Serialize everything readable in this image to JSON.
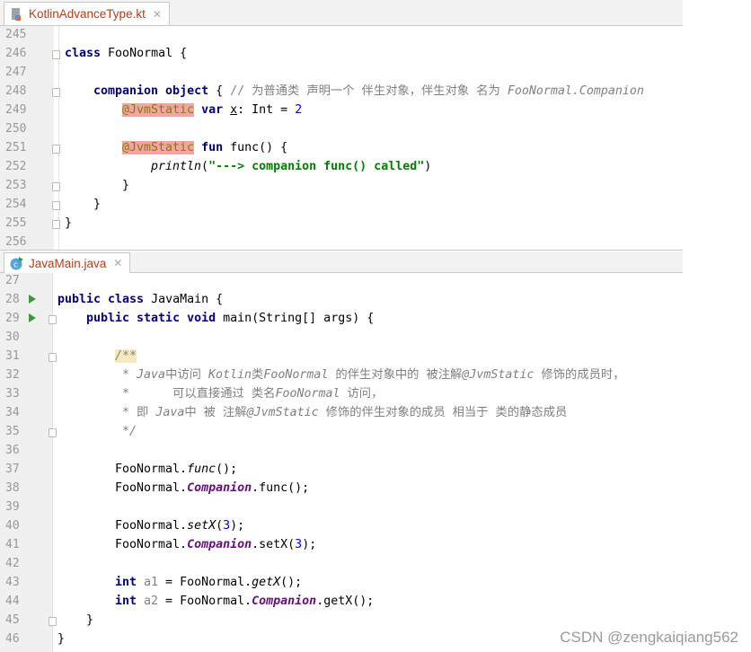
{
  "top_editor": {
    "tab": {
      "label": "KotlinAdvanceType.kt",
      "icon": "kotlin-file-icon"
    },
    "lines": [
      {
        "n": "245",
        "indent": 0,
        "fold": false,
        "tokens": []
      },
      {
        "n": "246",
        "indent": 0,
        "fold": true,
        "tokens": [
          [
            "class ",
            "kw0"
          ],
          [
            "FooNormal {",
            ""
          ]
        ]
      },
      {
        "n": "247",
        "indent": 0,
        "fold": false,
        "tokens": []
      },
      {
        "n": "248",
        "indent": 4,
        "fold": true,
        "tokens": [
          [
            "companion object",
            "kw"
          ],
          [
            " { ",
            ""
          ],
          [
            "// 为普通类 声明一个 伴生对象，伴生对象 名为 ",
            "cmt"
          ],
          [
            "FooNormal.Companion",
            "cm"
          ]
        ]
      },
      {
        "n": "249",
        "indent": 8,
        "fold": false,
        "tokens": [
          [
            "@JvmStatic",
            "ann"
          ],
          [
            " ",
            ""
          ],
          [
            "var",
            "kw"
          ],
          [
            " ",
            ""
          ],
          [
            "x",
            "und"
          ],
          [
            ": Int = ",
            ""
          ],
          [
            "2",
            "num"
          ]
        ]
      },
      {
        "n": "250",
        "indent": 0,
        "fold": false,
        "tokens": []
      },
      {
        "n": "251",
        "indent": 8,
        "fold": true,
        "tokens": [
          [
            "@JvmStatic",
            "ann"
          ],
          [
            " ",
            ""
          ],
          [
            "fun",
            "kw"
          ],
          [
            " func() {",
            ""
          ]
        ]
      },
      {
        "n": "252",
        "indent": 12,
        "fold": false,
        "tokens": [
          [
            "println",
            "it"
          ],
          [
            "(",
            ""
          ],
          [
            "\"---> companion func() called\"",
            "str"
          ],
          [
            ")",
            ""
          ]
        ]
      },
      {
        "n": "253",
        "indent": 8,
        "fold": true,
        "tokens": [
          [
            "}",
            ""
          ]
        ]
      },
      {
        "n": "254",
        "indent": 4,
        "fold": true,
        "tokens": [
          [
            "}",
            ""
          ]
        ]
      },
      {
        "n": "255",
        "indent": 0,
        "fold": true,
        "tokens": [
          [
            "}",
            ""
          ]
        ]
      },
      {
        "n": "256",
        "indent": 0,
        "fold": false,
        "tokens": []
      }
    ]
  },
  "bottom_editor": {
    "tab": {
      "label": "JavaMain.java",
      "icon": "java-class-runnable-icon"
    },
    "lines": [
      {
        "n": "27",
        "indent": 0,
        "fold": false,
        "run": false,
        "tokens": []
      },
      {
        "n": "28",
        "indent": 0,
        "fold": false,
        "run": true,
        "tokens": [
          [
            "public class ",
            "kw"
          ],
          [
            "JavaMain {",
            ""
          ]
        ]
      },
      {
        "n": "29",
        "indent": 4,
        "fold": true,
        "run": true,
        "tokens": [
          [
            "public static void ",
            "kw"
          ],
          [
            "main(String[] args) {",
            ""
          ]
        ]
      },
      {
        "n": "30",
        "indent": 0,
        "fold": false,
        "run": false,
        "tokens": []
      },
      {
        "n": "31",
        "indent": 8,
        "fold": true,
        "run": false,
        "tokens": [
          [
            "/**",
            "doc"
          ]
        ]
      },
      {
        "n": "32",
        "indent": 8,
        "fold": false,
        "run": false,
        "tokens": [
          [
            " * ",
            "cm"
          ],
          [
            "Java",
            "cm"
          ],
          [
            "中访问 ",
            "cmt"
          ],
          [
            "Kotlin",
            "cm"
          ],
          [
            "类",
            "cmt"
          ],
          [
            "FooNormal",
            "cm"
          ],
          [
            " 的伴生对象中的 被注解",
            "cmt"
          ],
          [
            "@JvmStatic",
            "cm"
          ],
          [
            " 修饰的成员时，",
            "cmt"
          ]
        ]
      },
      {
        "n": "33",
        "indent": 8,
        "fold": false,
        "run": false,
        "tokens": [
          [
            " *      ",
            "cm"
          ],
          [
            "可以直接通过 类名",
            "cmt"
          ],
          [
            "FooNormal",
            "cm"
          ],
          [
            " 访问，",
            "cmt"
          ]
        ]
      },
      {
        "n": "34",
        "indent": 8,
        "fold": false,
        "run": false,
        "tokens": [
          [
            " * ",
            "cm"
          ],
          [
            "即 ",
            "cmt"
          ],
          [
            "Java",
            "cm"
          ],
          [
            "中 被 注解",
            "cmt"
          ],
          [
            "@JvmStatic",
            "cm"
          ],
          [
            " 修饰的伴生对象的成员 相当于 类的静态成员",
            "cmt"
          ]
        ]
      },
      {
        "n": "35",
        "indent": 8,
        "fold": true,
        "run": false,
        "tokens": [
          [
            " */",
            "cm"
          ]
        ]
      },
      {
        "n": "36",
        "indent": 0,
        "fold": false,
        "run": false,
        "tokens": []
      },
      {
        "n": "37",
        "indent": 8,
        "fold": false,
        "run": false,
        "tokens": [
          [
            "FooNormal.",
            ""
          ],
          [
            "func",
            "it"
          ],
          [
            "();",
            ""
          ]
        ]
      },
      {
        "n": "38",
        "indent": 8,
        "fold": false,
        "run": false,
        "tokens": [
          [
            "FooNormal.",
            ""
          ],
          [
            "Companion",
            "stat"
          ],
          [
            ".func();",
            ""
          ]
        ]
      },
      {
        "n": "39",
        "indent": 0,
        "fold": false,
        "run": false,
        "tokens": []
      },
      {
        "n": "40",
        "indent": 8,
        "fold": false,
        "run": false,
        "tokens": [
          [
            "FooNormal.",
            ""
          ],
          [
            "setX",
            "it"
          ],
          [
            "(",
            ""
          ],
          [
            "3",
            "num"
          ],
          [
            ");",
            ""
          ]
        ]
      },
      {
        "n": "41",
        "indent": 8,
        "fold": false,
        "run": false,
        "tokens": [
          [
            "FooNormal.",
            ""
          ],
          [
            "Companion",
            "stat"
          ],
          [
            ".setX(",
            ""
          ],
          [
            "3",
            "num"
          ],
          [
            ");",
            ""
          ]
        ]
      },
      {
        "n": "42",
        "indent": 0,
        "fold": false,
        "run": false,
        "tokens": []
      },
      {
        "n": "43",
        "indent": 8,
        "fold": false,
        "run": false,
        "tokens": [
          [
            "int ",
            "kw"
          ],
          [
            "a1",
            "var"
          ],
          [
            " = FooNormal.",
            ""
          ],
          [
            "getX",
            "it"
          ],
          [
            "();",
            ""
          ]
        ]
      },
      {
        "n": "44",
        "indent": 8,
        "fold": false,
        "run": false,
        "tokens": [
          [
            "int ",
            "kw"
          ],
          [
            "a2",
            "var"
          ],
          [
            " = FooNormal.",
            ""
          ],
          [
            "Companion",
            "stat"
          ],
          [
            ".getX();",
            ""
          ]
        ]
      },
      {
        "n": "45",
        "indent": 4,
        "fold": true,
        "run": false,
        "tokens": [
          [
            "}",
            ""
          ]
        ]
      },
      {
        "n": "46",
        "indent": 0,
        "fold": false,
        "run": false,
        "tokens": [
          [
            "}",
            ""
          ]
        ]
      }
    ]
  },
  "watermark": "CSDN @zengkaiqiang562"
}
